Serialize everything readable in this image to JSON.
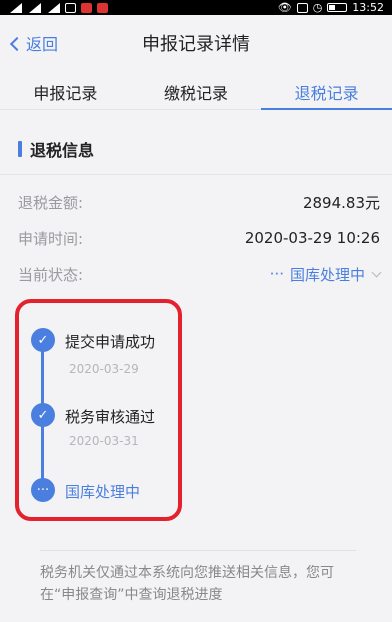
{
  "status_bar": {
    "time": "13:52"
  },
  "nav": {
    "back_label": "返回",
    "title": "申报记录详情"
  },
  "tabs": [
    {
      "label": "申报记录"
    },
    {
      "label": "缴税记录"
    },
    {
      "label": "退税记录"
    }
  ],
  "section": {
    "title": "退税信息"
  },
  "info": {
    "amount_label": "退税金额:",
    "amount_value": "2894.83元",
    "time_label": "申请时间:",
    "time_value": "2020-03-29 10:26",
    "status_label": "当前状态:",
    "status_dots": "···",
    "status_value": "国库处理中"
  },
  "timeline": [
    {
      "title": "提交申请成功",
      "date": "2020-03-29",
      "icon": "check-icon"
    },
    {
      "title": "税务审核通过",
      "date": "2020-03-31",
      "icon": "check-icon"
    },
    {
      "title": "国库处理中",
      "date": "",
      "icon": "ellipsis-icon"
    }
  ],
  "notice": "税务机关仅通过本系统向您推送相关信息，您可在“申报查询”中查询退税进度",
  "colors": {
    "accent": "#4a7fe0",
    "highlight": "#e3222d"
  }
}
